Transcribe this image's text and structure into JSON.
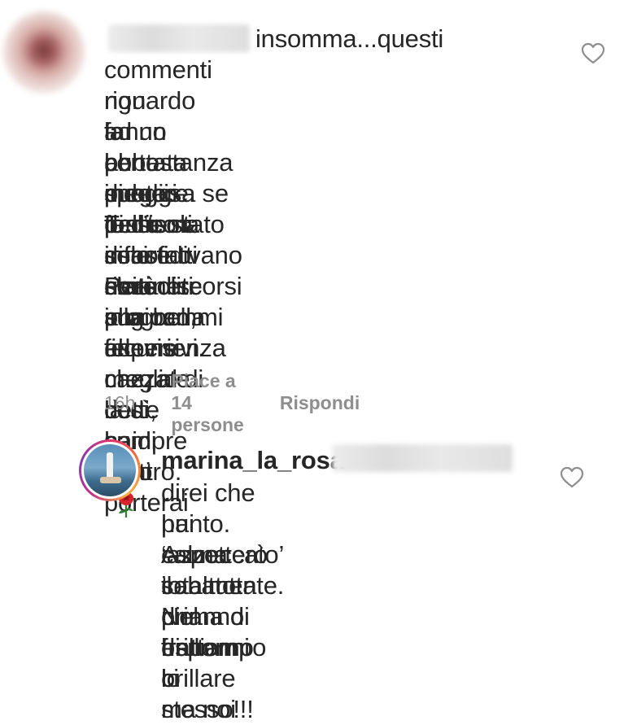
{
  "comment1": {
    "text_lines": [
      "insomma...questi",
      "commenti riguardo la puntata di oggi",
      "non fanno ben sperare. Ti dico solo che",
      "ad un certo punto dell’isola sono stata",
      "abbastanza indecisa se fosse stato",
      "meglio per te uscire o rimanere in gioco,",
      "tanto mi infastidivano certi discorsi su",
      "di te fatti nei soliti programmi televisivi.",
      "Però alla fine meglio così, hai fatto",
      "una bella esperienza che, al di là di",
      "alcune cazzate dette su di te, ti porterai",
      "sempre dentro."
    ],
    "emoji": "rose-icon",
    "time": "16h",
    "likes": "Piace a 14 persone",
    "reply_label": "Rispondi"
  },
  "comment2": {
    "username": "marina_la_rosa",
    "text_lines": [
      "direi che hai ‘azzeccato’ il",
      "punto. Aspetterò con tutta",
      "calma sabato prima di espormi",
      "totalmente. Nel frattempo ci",
      "diranno di non brillare ma noi",
      "brilliamo lo stesso!!!"
    ]
  },
  "icons": {
    "like": "heart-outline-icon"
  },
  "colors": {
    "text": "#262626",
    "meta": "#8e8e8e",
    "rose": "#d8242c"
  }
}
